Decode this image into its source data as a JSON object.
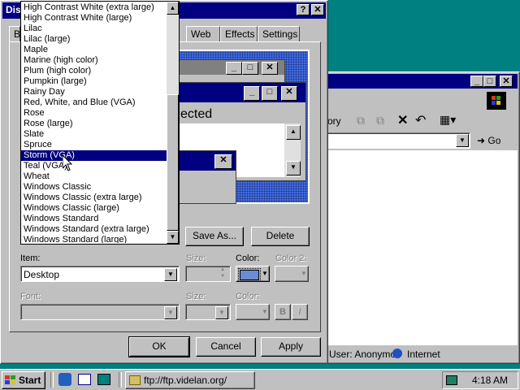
{
  "colors": {
    "desktop": "#008080",
    "titlebar": "#000080",
    "face": "#c0c0c0",
    "selection": "#000080",
    "preview_pattern": "#4169e1"
  },
  "dialog": {
    "title": "Disp",
    "tabs": [
      "B",
      "Web",
      "Effects",
      "Settings"
    ],
    "scheme_list": [
      "High Contrast White (extra large)",
      "High Contrast White (large)",
      "Lilac",
      "Lilac (large)",
      "Maple",
      "Marine (high color)",
      "Plum (high color)",
      "Pumpkin (large)",
      "Rainy Day",
      "Red, White, and Blue (VGA)",
      "Rose",
      "Rose (large)",
      "Slate",
      "Spruce",
      "Storm (VGA)",
      "Teal (VGA)",
      "Wheat",
      "Windows Classic",
      "Windows Classic (extra large)",
      "Windows Classic (large)",
      "Windows Standard",
      "Windows Standard (extra large)",
      "Windows Standard (large)"
    ],
    "selected_scheme": "Storm (VGA)",
    "preview": {
      "selected_text": "ected"
    },
    "save_as_label": "Save As...",
    "delete_label": "Delete",
    "item_label": "Item:",
    "item_value": "Desktop",
    "size_label": "Size:",
    "color_label": "Color:",
    "color2_label": "Color 2:",
    "font_label": "Font:",
    "size2_label": "Size:",
    "color3_label": "Color:",
    "bold_label": "B",
    "italic_label": "I",
    "ok_label": "OK",
    "cancel_label": "Cancel",
    "apply_label": "Apply",
    "selected_color": "#6a8cd6"
  },
  "explorer": {
    "toolbar_label": "ory",
    "go_label": "Go",
    "status_user": "User: Anonymo",
    "status_zone": "Internet"
  },
  "taskbar": {
    "start_label": "Start",
    "task_label": "ftp://ftp.videlan.org/",
    "clock": "4:18 AM"
  }
}
